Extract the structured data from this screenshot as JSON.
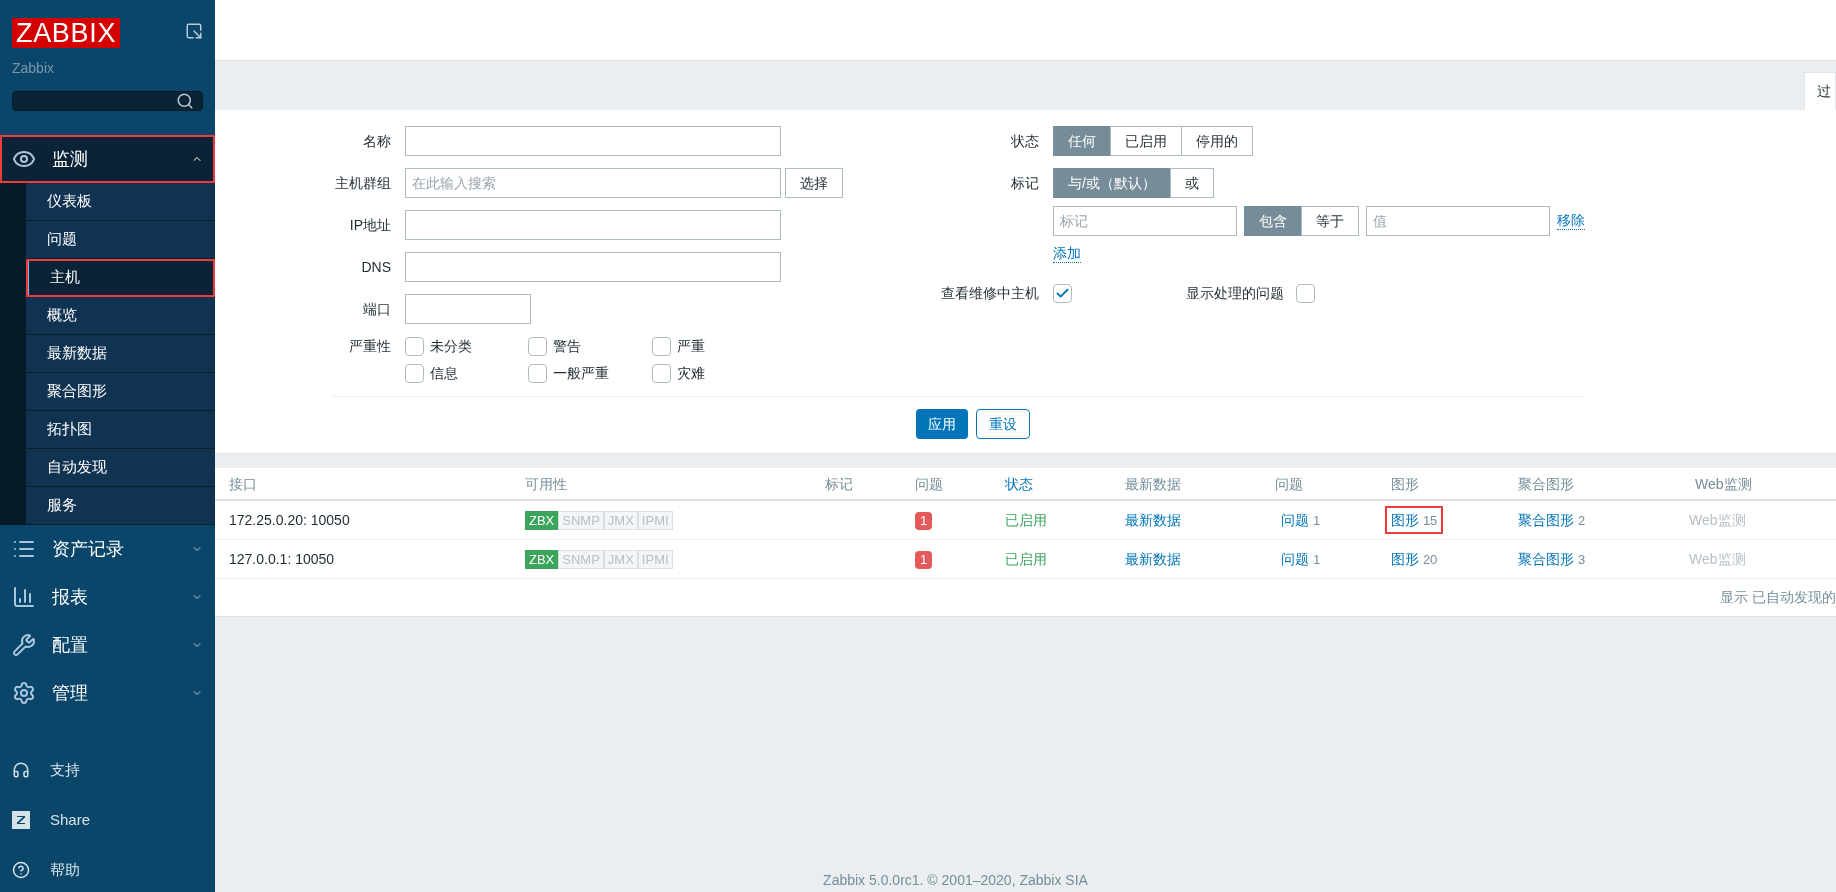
{
  "sidebar": {
    "logo": "ZABBIX",
    "subtitle": "Zabbix",
    "menu": [
      {
        "label": "监测",
        "expanded": true,
        "highlighted": true,
        "children": [
          {
            "label": "仪表板",
            "selected": false,
            "highlighted": false
          },
          {
            "label": "问题",
            "selected": false,
            "highlighted": false
          },
          {
            "label": "主机",
            "selected": true,
            "highlighted": true
          },
          {
            "label": "概览",
            "selected": false,
            "highlighted": false
          },
          {
            "label": "最新数据",
            "selected": false,
            "highlighted": false
          },
          {
            "label": "聚合图形",
            "selected": false,
            "highlighted": false
          },
          {
            "label": "拓扑图",
            "selected": false,
            "highlighted": false
          },
          {
            "label": "自动发现",
            "selected": false,
            "highlighted": false
          },
          {
            "label": "服务",
            "selected": false,
            "highlighted": false
          }
        ]
      },
      {
        "label": "资产记录",
        "expanded": false,
        "highlighted": false
      },
      {
        "label": "报表",
        "expanded": false,
        "highlighted": false
      },
      {
        "label": "配置",
        "expanded": false,
        "highlighted": false
      },
      {
        "label": "管理",
        "expanded": false,
        "highlighted": false
      }
    ],
    "footer_links": [
      {
        "label": "支持"
      },
      {
        "label": "Share"
      },
      {
        "label": "帮助"
      }
    ]
  },
  "filter": {
    "tab": "过",
    "left": [
      {
        "kind": "input",
        "label": "名称"
      },
      {
        "kind": "multiselect",
        "label": "主机群组",
        "placeholder": "在此输入搜索",
        "button": "选择"
      },
      {
        "kind": "input",
        "label": "IP地址"
      },
      {
        "kind": "input",
        "label": "DNS"
      },
      {
        "kind": "short",
        "label": "端口"
      }
    ],
    "severity": {
      "label": "严重性",
      "options": [
        {
          "label": "未分类",
          "checked": false
        },
        {
          "label": "警告",
          "checked": false
        },
        {
          "label": "严重",
          "checked": false
        },
        {
          "label": "信息",
          "checked": false
        },
        {
          "label": "一般严重",
          "checked": false
        },
        {
          "label": "灾难",
          "checked": false
        }
      ]
    },
    "status": {
      "label": "状态",
      "options": [
        {
          "label": "任何",
          "selected": true
        },
        {
          "label": "已启用",
          "selected": false
        },
        {
          "label": "停用的",
          "selected": false
        }
      ]
    },
    "tags": {
      "label": "标记",
      "options": [
        {
          "label": "与/或（默认）",
          "selected": true
        },
        {
          "label": "或",
          "selected": false
        }
      ],
      "tag_placeholder": "标记",
      "operators": [
        {
          "label": "包含",
          "selected": true
        },
        {
          "label": "等于",
          "selected": false
        }
      ],
      "value_placeholder": "值",
      "remove": "移除",
      "add": "添加"
    },
    "maintenance": {
      "label": "查看维修中主机",
      "checked": true
    },
    "suppressed": {
      "label": "显示处理的问题",
      "checked": false
    },
    "apply": "应用",
    "reset": "重设"
  },
  "table": {
    "columns": [
      {
        "label": "接口",
        "sortable": false
      },
      {
        "label": "可用性",
        "sortable": false
      },
      {
        "label": "标记",
        "sortable": false
      },
      {
        "label": "问题",
        "sortable": false
      },
      {
        "label": "状态",
        "sortable": true
      },
      {
        "label": "最新数据",
        "sortable": false
      },
      {
        "label": "问题",
        "sortable": false
      },
      {
        "label": "图形",
        "sortable": false
      },
      {
        "label": "聚合图形",
        "sortable": false
      },
      {
        "label": "Web监测",
        "sortable": false
      }
    ],
    "rows": [
      {
        "interface": "172.25.0.20: 10050",
        "availability": [
          {
            "label": "ZBX",
            "on": true
          },
          {
            "label": "SNMP",
            "on": false
          },
          {
            "label": "JMX",
            "on": false
          },
          {
            "label": "IPMI",
            "on": false
          }
        ],
        "problems": "1",
        "status": "已启用",
        "latest": "最新数据",
        "problems_link": {
          "label": "问题",
          "count": "1"
        },
        "graphs": {
          "label": "图形",
          "count": "15",
          "highlighted": true
        },
        "screens": {
          "label": "聚合图形",
          "count": "2"
        },
        "web": {
          "label": "Web监测",
          "disabled": true
        }
      },
      {
        "interface": "127.0.0.1: 10050",
        "availability": [
          {
            "label": "ZBX",
            "on": true
          },
          {
            "label": "SNMP",
            "on": false
          },
          {
            "label": "JMX",
            "on": false
          },
          {
            "label": "IPMI",
            "on": false
          }
        ],
        "problems": "1",
        "status": "已启用",
        "latest": "最新数据",
        "problems_link": {
          "label": "问题",
          "count": "1"
        },
        "graphs": {
          "label": "图形",
          "count": "20",
          "highlighted": false
        },
        "screens": {
          "label": "聚合图形",
          "count": "3"
        },
        "web": {
          "label": "Web监测",
          "disabled": true
        }
      }
    ],
    "pager": "显示 已自动发现的"
  },
  "footer": "Zabbix 5.0.0rc1. © 2001–2020, Zabbix SIA"
}
